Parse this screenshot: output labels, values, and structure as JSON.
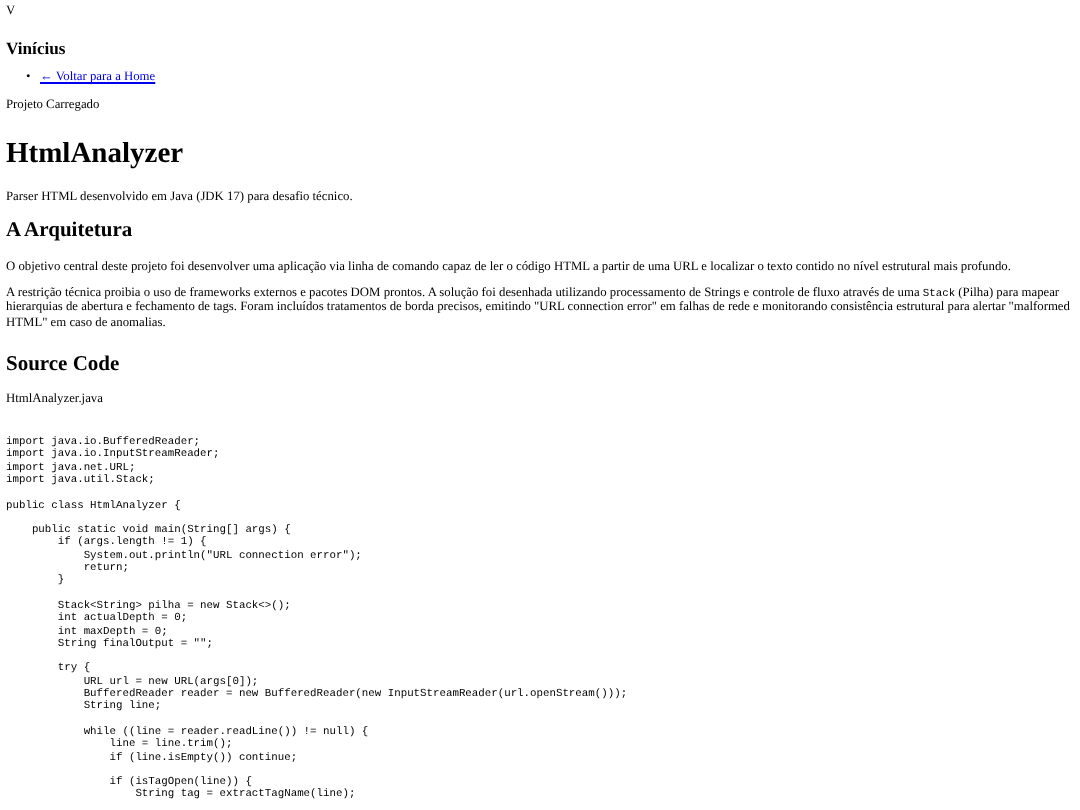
{
  "top_letter": "V",
  "author": "Vinícius",
  "nav_links": [
    {
      "bullet": "•",
      "text": "← Voltar para a Home"
    }
  ],
  "status": "Projeto Carregado",
  "title": "HtmlAnalyzer",
  "subtitle": "Parser HTML desenvolvido em Java (JDK 17) para desafio técnico.",
  "architecture": {
    "heading": "A Arquitetura",
    "paragraphs": [
      {
        "parts": [
          {
            "text": "O objetivo central deste projeto foi desenvolver uma aplicação via linha de comando capaz de ler o código HTML a partir de uma URL e localizar o texto contido no nível estrutural mais profundo.",
            "kind": "text"
          }
        ]
      },
      {
        "parts": [
          {
            "text": "A restrição técnica proibia o uso de frameworks externos e pacotes DOM prontos. A solução foi desenhada utilizando processamento de Strings e controle de fluxo através de uma ",
            "kind": "text"
          },
          {
            "text": "Stack",
            "kind": "code"
          },
          {
            "text": " (Pilha) para mapear hierarquias de abertura e fechamento de tags. Foram incluídos tratamentos de borda precisos, emitindo \"URL connection error\" em falhas de rede e monitorando consistência estrutural para alertar \"malformed HTML\" em caso de anomalias.",
            "kind": "text"
          }
        ]
      }
    ]
  },
  "source": {
    "heading": "Source Code",
    "filename": "HtmlAnalyzer.java",
    "code_blocks": [
      [
        "import java.io.BufferedReader;",
        "import java.io.InputStreamReader;",
        "import java.net.URL;",
        "import java.util.Stack;"
      ],
      [
        "public class HtmlAnalyzer {"
      ],
      [
        "    public static void main(String[] args) {",
        "        if (args.length != 1) {",
        "            System.out.println(\"URL connection error\");",
        "            return;",
        "        }"
      ],
      [
        "        Stack<String> pilha = new Stack<>();",
        "        int actualDepth = 0;",
        "        int maxDepth = 0;",
        "        String finalOutput = \"\";"
      ],
      [
        "        try {",
        "            URL url = new URL(args[0]);",
        "            BufferedReader reader = new BufferedReader(new InputStreamReader(url.openStream()));",
        "            String line;"
      ],
      [
        "            while ((line = reader.readLine()) != null) {",
        "                line = line.trim();",
        "                if (line.isEmpty()) continue;"
      ],
      [
        "                if (isTagOpen(line)) {",
        "                    String tag = extractTagName(line);"
      ]
    ]
  }
}
